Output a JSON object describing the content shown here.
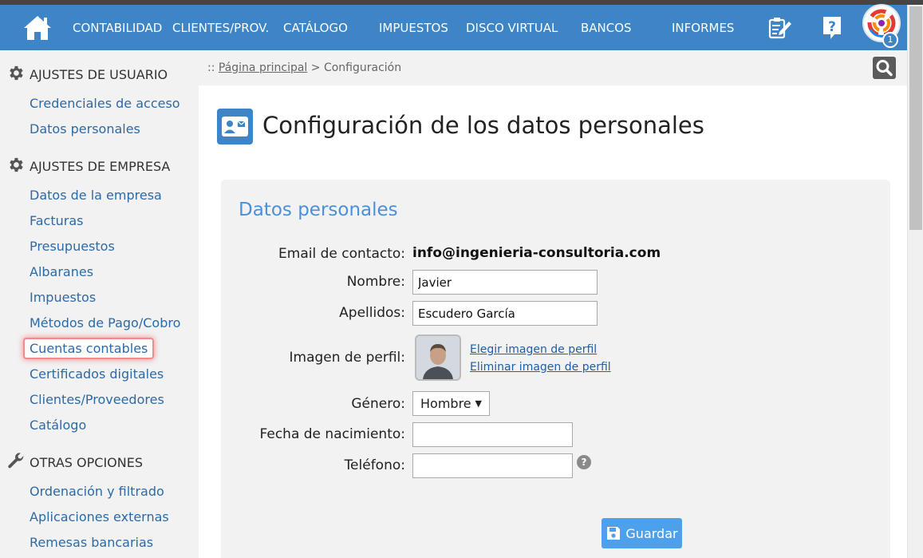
{
  "nav": {
    "items": [
      {
        "label": "CONTABILIDAD"
      },
      {
        "label": "CLIENTES/PROV."
      },
      {
        "label": "CATÁLOGO"
      },
      {
        "label": "IMPUESTOS"
      },
      {
        "label": "DISCO VIRTUAL"
      },
      {
        "label": "BANCOS"
      },
      {
        "label": "INFORMES"
      }
    ],
    "icons": [
      "home-icon",
      "notes-edit-icon",
      "help-icon",
      "app-logo-icon"
    ],
    "notification_count": "1",
    "accent_color": "#3d85c6"
  },
  "sidebar": {
    "sections": [
      {
        "title": "AJUSTES DE USUARIO",
        "icon": "gear-icon",
        "items": [
          "Credenciales de acceso",
          "Datos personales"
        ]
      },
      {
        "title": "AJUSTES DE EMPRESA",
        "icon": "gear-icon",
        "items": [
          "Datos de la empresa",
          "Facturas",
          "Presupuestos",
          "Albaranes",
          "Impuestos",
          "Métodos de Pago/Cobro",
          "Cuentas contables",
          "Certificados digitales",
          "Clientes/Proveedores",
          "Catálogo"
        ]
      },
      {
        "title": "OTRAS OPCIONES",
        "icon": "wrench-icon",
        "items": [
          "Ordenación y filtrado",
          "Aplicaciones externas",
          "Remesas bancarias"
        ]
      }
    ],
    "highlighted_item": "Cuentas contables",
    "highlight_color": "#f28b8b"
  },
  "breadcrumb": {
    "prefix": "::",
    "home": "Página principal",
    "separator": ">",
    "current": "Configuración"
  },
  "page": {
    "title": "Configuración de los datos personales",
    "icon": "contact-card-icon"
  },
  "form": {
    "section_title": "Datos personales",
    "email_label": "Email de contacto:",
    "email_value": "info@ingenieria-consultoria.com",
    "nombre_label": "Nombre:",
    "nombre_value": "Javier",
    "apellidos_label": "Apellidos:",
    "apellidos_value": "Escudero García",
    "imagen_label": "Imagen de perfil:",
    "elegir_link": "Elegir imagen de perfil",
    "eliminar_link": "Eliminar imagen de perfil",
    "genero_label": "Género:",
    "genero_value": "Hombre",
    "fecha_label": "Fecha de nacimiento:",
    "fecha_value": "",
    "telefono_label": "Teléfono:",
    "telefono_value": "",
    "save_label": "Guardar",
    "save_color": "#4da1ec"
  }
}
